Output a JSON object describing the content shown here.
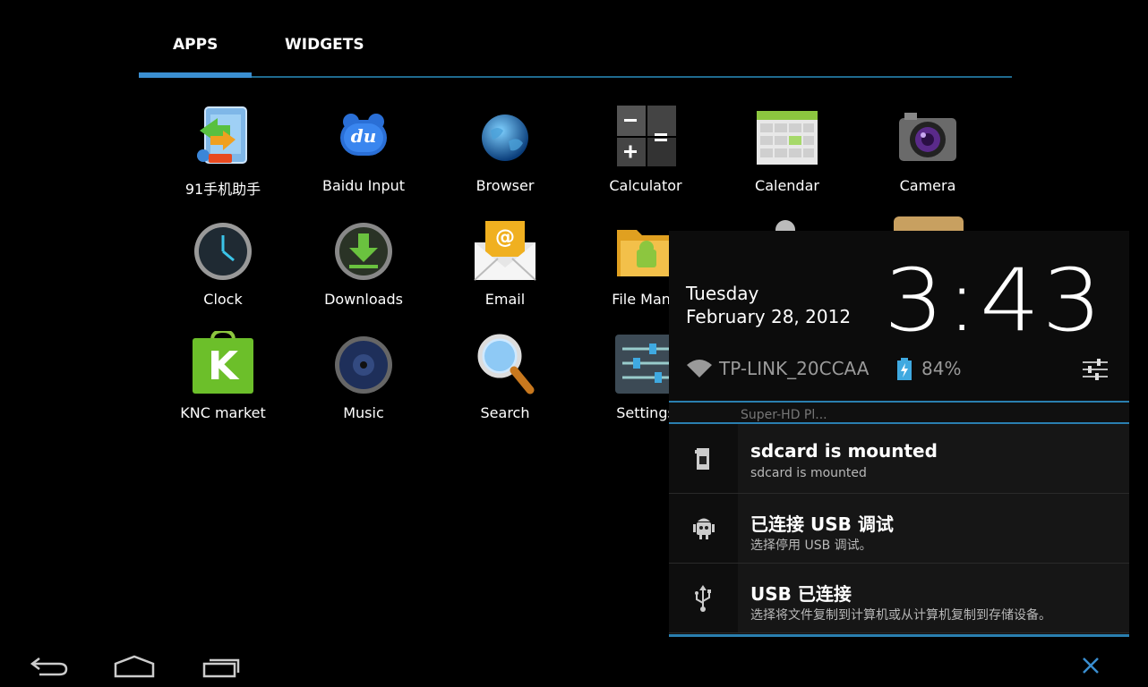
{
  "tabs": {
    "apps": "APPS",
    "widgets": "WIDGETS"
  },
  "apps": [
    {
      "label": "91手机助手",
      "icon": "91-assistant-icon"
    },
    {
      "label": "Baidu Input",
      "icon": "baidu-input-icon",
      "glyph": "du"
    },
    {
      "label": "Browser",
      "icon": "globe-icon"
    },
    {
      "label": "Calculator",
      "icon": "calculator-icon"
    },
    {
      "label": "Calendar",
      "icon": "calendar-icon"
    },
    {
      "label": "Camera",
      "icon": "camera-icon"
    },
    {
      "label": "Clock",
      "icon": "clock-icon"
    },
    {
      "label": "Downloads",
      "icon": "download-icon"
    },
    {
      "label": "Email",
      "icon": "email-icon",
      "glyph": "@"
    },
    {
      "label": "File Mana",
      "icon": "file-manager-icon"
    },
    {
      "label": "KNC market",
      "icon": "knc-market-icon",
      "glyph": "K"
    },
    {
      "label": "Music",
      "icon": "music-icon"
    },
    {
      "label": "Search",
      "icon": "search-icon"
    },
    {
      "label": "Settings",
      "icon": "settings-icon"
    }
  ],
  "panel": {
    "day": "Tuesday",
    "date": "February 28, 2012",
    "time": "3:43",
    "wifi_ssid": "TP-LINK_20CCAA",
    "battery": "84%",
    "ghost_text": "Super-HD Pl...",
    "notifications": [
      {
        "title": "sdcard is mounted",
        "subtitle": "sdcard is mounted",
        "icon": "sdcard-icon"
      },
      {
        "title": "已连接 USB 调试",
        "subtitle": "选择停用 USB 调试。",
        "icon": "android-debug-icon"
      },
      {
        "title": "USB 已连接",
        "subtitle": "选择将文件复制到计算机或从计算机复制到存储设备。",
        "icon": "usb-icon"
      }
    ]
  },
  "colors": {
    "accent": "#3a8ed0",
    "accent_dark": "#2a7fb0"
  }
}
